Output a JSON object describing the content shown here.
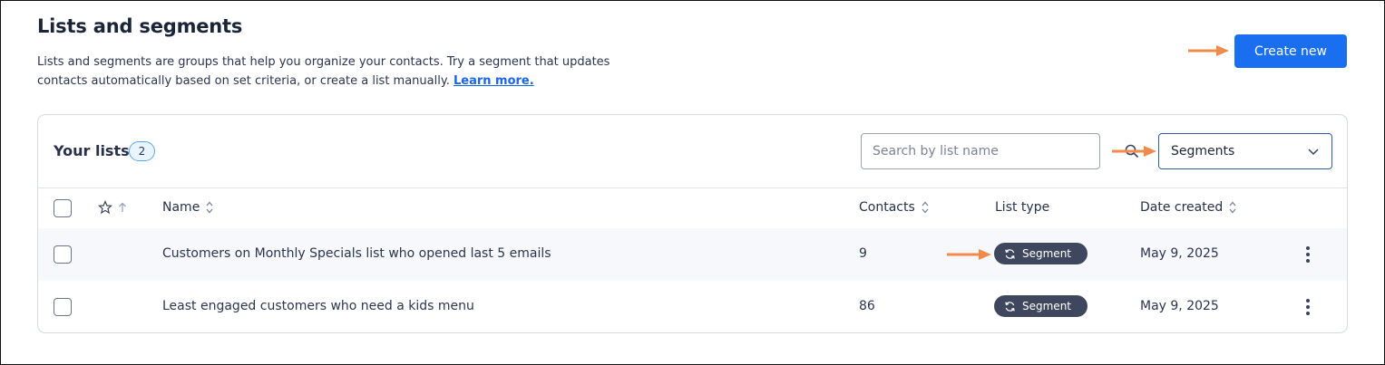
{
  "header": {
    "title": "Lists and segments",
    "description": "Lists and segments are groups that help you organize your contacts. Try a segment that updates contacts automatically based on set criteria, or create a list manually.",
    "learn_more": "Learn more.",
    "create_button": "Create new"
  },
  "lists_card": {
    "title": "Your lists",
    "count": "2",
    "search_placeholder": "Search by list name",
    "filter_selected": "Segments"
  },
  "table": {
    "columns": {
      "name": "Name",
      "contacts": "Contacts",
      "list_type": "List type",
      "date_created": "Date created"
    },
    "rows": [
      {
        "name": "Customers on Monthly Specials list who opened last 5 emails",
        "contacts": "9",
        "list_type": "Segment",
        "date_created": "May 9, 2025"
      },
      {
        "name": "Least engaged customers who need a kids menu",
        "contacts": "86",
        "list_type": "Segment",
        "date_created": "May 9, 2025"
      }
    ]
  },
  "colors": {
    "primary_button": "#1a6ff0",
    "link": "#1a66e8",
    "segment_pill": "#3e475d",
    "annotation_arrow": "#f28a4b"
  },
  "icons": [
    "search-icon",
    "chevron-down-icon",
    "star-icon",
    "sort-up-icon",
    "sort-icon",
    "sync-icon",
    "kebab-menu-icon",
    "annotation-arrow-icon"
  ]
}
